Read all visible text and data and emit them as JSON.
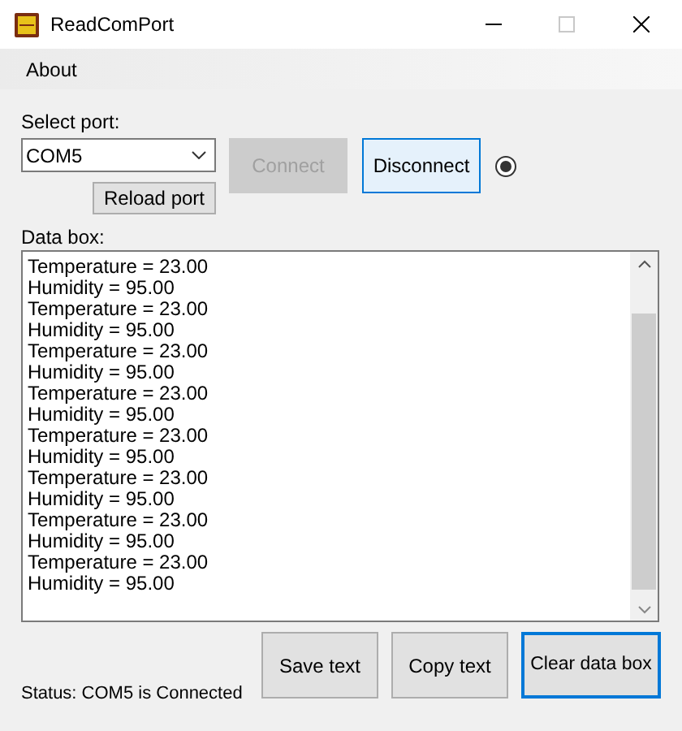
{
  "window": {
    "title": "ReadComPort"
  },
  "menu": [
    {
      "label": "About"
    }
  ],
  "port": {
    "label": "Select port:",
    "value": "COM5"
  },
  "buttons_top": [
    {
      "label": "Reload port",
      "disabled": false,
      "focused": false
    },
    {
      "label": "Connect",
      "disabled": true,
      "focused": false
    },
    {
      "label": "Disconnect",
      "disabled": false,
      "focused": true
    }
  ],
  "indicator": {
    "selected": true
  },
  "data_box": {
    "label": "Data box:",
    "lines": [
      "Temperature = 23.00",
      "Humidity = 95.00",
      "Temperature = 23.00",
      "Humidity = 95.00",
      "Temperature = 23.00",
      "Humidity = 95.00",
      "Temperature = 23.00",
      "Humidity = 95.00",
      "Temperature = 23.00",
      "Humidity = 95.00",
      "Temperature = 23.00",
      "Humidity = 95.00",
      "Temperature = 23.00",
      "Humidity = 95.00",
      "Temperature = 23.00",
      "Humidity = 95.00"
    ]
  },
  "status_bar": "Status: COM5 is Connected",
  "buttons_bottom": [
    {
      "label": "Save text",
      "focused": false
    },
    {
      "label": "Copy text",
      "focused": false
    },
    {
      "label": "Clear data box",
      "focused": true
    }
  ]
}
